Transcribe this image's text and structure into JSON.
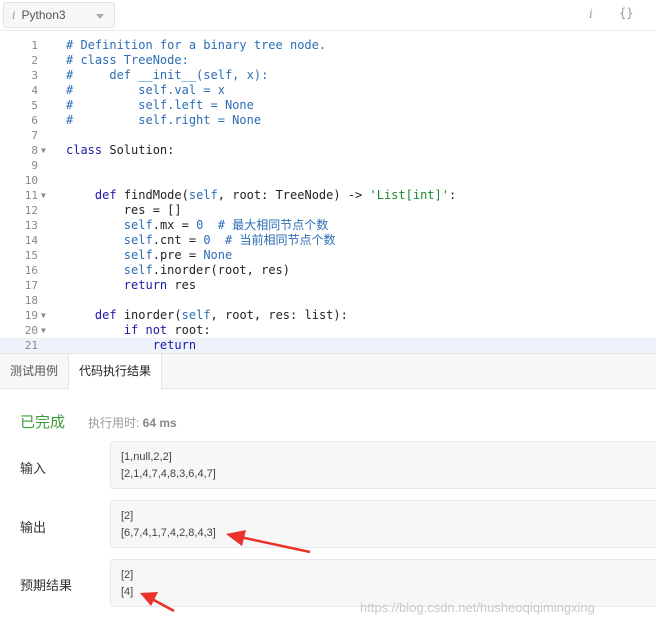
{
  "toolbar": {
    "language": "Python3",
    "info_icon_glyph": "i",
    "braces_glyph": "{}"
  },
  "editor": {
    "lines": [
      {
        "n": "1",
        "text": "# Definition for a binary tree node."
      },
      {
        "n": "2",
        "text": "# class TreeNode:"
      },
      {
        "n": "3",
        "text": "#     def __init__(self, x):"
      },
      {
        "n": "4",
        "text": "#         self.val = x"
      },
      {
        "n": "5",
        "text": "#         self.left = None"
      },
      {
        "n": "6",
        "text": "#         self.right = None"
      },
      {
        "n": "7",
        "text": ""
      },
      {
        "n": "8",
        "text": "class Solution:"
      },
      {
        "n": "9",
        "text": ""
      },
      {
        "n": "10",
        "text": ""
      },
      {
        "n": "11",
        "text": "    def findMode(self, root: TreeNode) -> 'List[int]':"
      },
      {
        "n": "12",
        "text": "        res = []"
      },
      {
        "n": "13",
        "text": "        self.mx = 0  # 最大相同节点个数"
      },
      {
        "n": "14",
        "text": "        self.cnt = 0  # 当前相同节点个数"
      },
      {
        "n": "15",
        "text": "        self.pre = None"
      },
      {
        "n": "16",
        "text": "        self.inorder(root, res)"
      },
      {
        "n": "17",
        "text": "        return res"
      },
      {
        "n": "18",
        "text": ""
      },
      {
        "n": "19",
        "text": "    def inorder(self, root, res: list):"
      },
      {
        "n": "20",
        "text": "        if not root:"
      },
      {
        "n": "21",
        "text": "            return"
      }
    ],
    "fold_lines": [
      "8",
      "11",
      "19",
      "20"
    ],
    "active_line": "21"
  },
  "tabs": [
    {
      "label": "测试用例",
      "active": false
    },
    {
      "label": "代码执行结果",
      "active": true
    }
  ],
  "result": {
    "status": "已完成",
    "runtime_label": "执行用时: ",
    "runtime_value": "64 ms",
    "input_label": "输入",
    "input_lines": [
      "[1,null,2,2]",
      "[2,1,4,7,4,8,3,6,4,7]"
    ],
    "output_label": "输出",
    "output_lines": [
      "[2]",
      "[6,7,4,1,7,4,2,8,4,3]"
    ],
    "expected_label": "预期结果",
    "expected_lines": [
      "[2]",
      "[4]"
    ]
  },
  "watermark": "https://blog.csdn.net/husheoqiqimingxing",
  "colors": {
    "status_green": "#3c9b3c",
    "annotation_arrow": "#e8322a",
    "comment_blue": "#2c6db5",
    "string_green": "#1a8a2a"
  }
}
